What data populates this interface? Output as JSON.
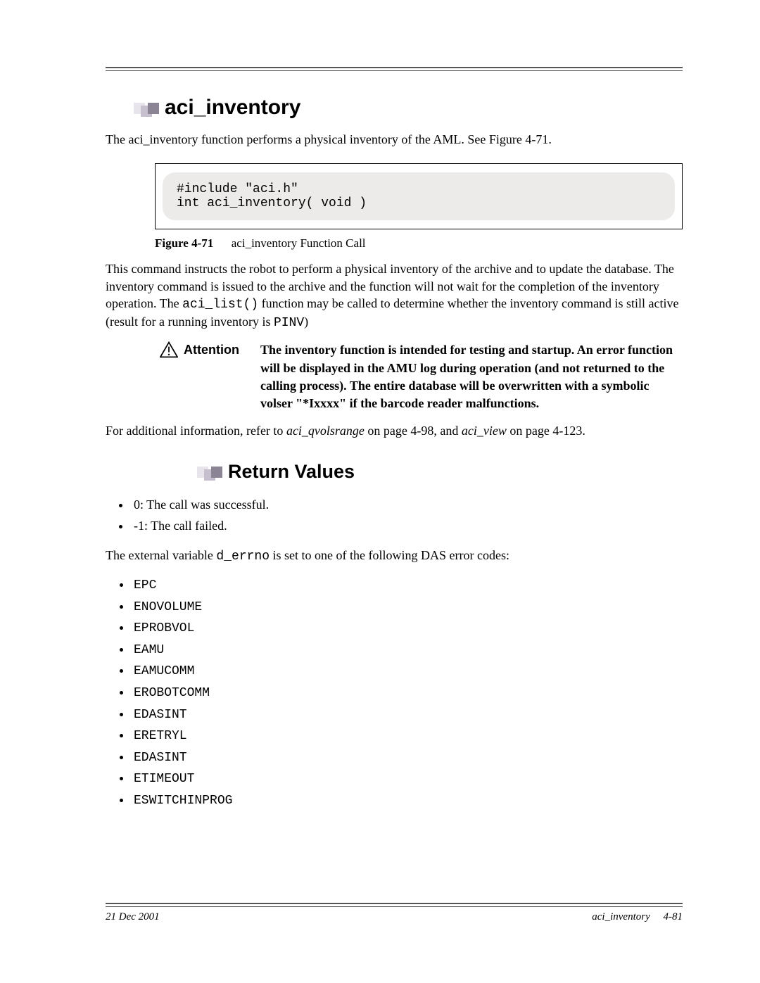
{
  "section_title": "aci_inventory",
  "intro": "The aci_inventory function performs a physical inventory of the AML. See Figure 4-71.",
  "code": "#include \"aci.h\"\nint aci_inventory( void )",
  "figure_label": "Figure 4-71",
  "figure_caption": "aci_inventory Function Call",
  "desc_part1": "This command instructs the robot to perform a physical inventory of the archive and to update the database. The inventory command is issued to the archive and the function will not wait for the completion of the inventory operation. The ",
  "desc_code1": "aci_list()",
  "desc_part2": " function may be called to determine whether the inventory command is still active (result for a running inventory is ",
  "desc_code2": "PINV",
  "desc_part3": ")",
  "attention_label": "Attention",
  "attention_text": "The inventory function is intended for testing and startup. An error function will be displayed in the AMU log during operation (and not returned to the calling process). The entire database will be overwritten with a symbolic volser \"*Ixxxx\" if the barcode reader malfunctions.",
  "crossref_part1": "For additional information, refer to ",
  "crossref_em1": "aci_qvolsrange",
  "crossref_part2": "  on page 4-98, and ",
  "crossref_em2": "aci_view",
  "crossref_part3": "  on page 4-123.",
  "return_title": "Return Values",
  "return_items": [
    "0: The call was successful.",
    "-1: The call failed."
  ],
  "errno_part1": "The external variable ",
  "errno_code": "d_errno",
  "errno_part2": " is set to one of the following DAS error codes:",
  "error_codes": [
    "EPC",
    "ENOVOLUME",
    "EPROBVOL",
    "EAMU",
    "EAMUCOMM",
    "EROBOTCOMM",
    "EDASINT",
    "ERETRYL",
    "EDASINT",
    "ETIMEOUT",
    "ESWITCHINPROG"
  ],
  "footer_date": "21 Dec 2001",
  "footer_section": "aci_inventory",
  "footer_page": "4-81"
}
